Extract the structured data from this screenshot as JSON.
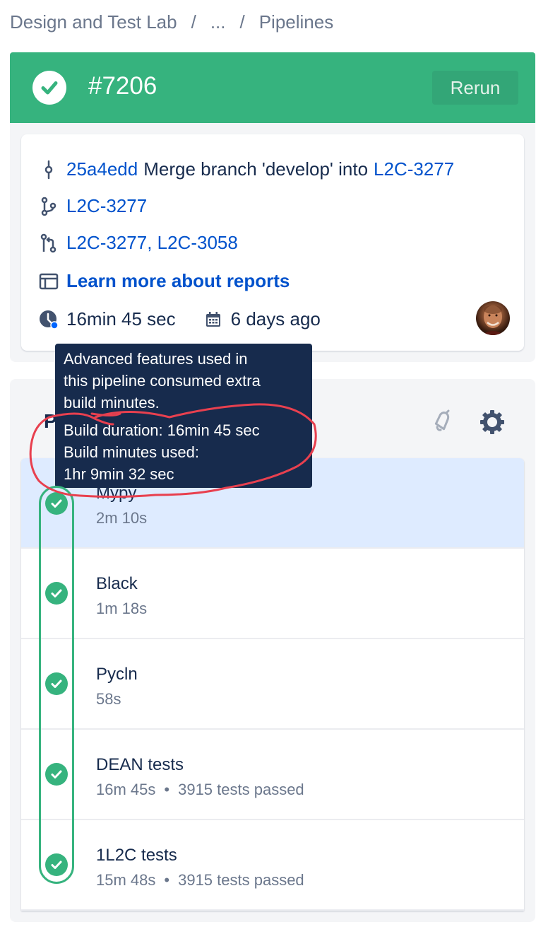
{
  "breadcrumb": {
    "items": [
      "Design and Test Lab",
      "...",
      "Pipelines"
    ],
    "separator": "/"
  },
  "header": {
    "status_icon": "check-circle-icon",
    "title": "#7206",
    "rerun_label": "Rerun",
    "color": "#36b37e"
  },
  "info": {
    "commit": {
      "icon": "commit-icon",
      "hash": "25a4edd",
      "message": "Merge branch 'develop' into",
      "target_branch": "L2C-3277"
    },
    "branch": {
      "icon": "branch-icon",
      "name": "L2C-3277"
    },
    "pull_requests": {
      "icon": "pull-request-icon",
      "text": "L2C-3277, L2C-3058"
    },
    "reports": {
      "icon": "report-icon",
      "label": "Learn more about reports"
    },
    "duration": {
      "icon": "clock-icon",
      "text": "16min 45 sec"
    },
    "date": {
      "icon": "calendar-icon",
      "text": "6 days ago"
    },
    "avatar": "user-avatar"
  },
  "tooltip": {
    "line1": "Advanced features used in",
    "line2": "this pipeline consumed extra",
    "line3": "build minutes.",
    "line4": "Build duration: 16min 45 sec",
    "line5": "Build minutes used:",
    "line6": "1hr 9min 32 sec"
  },
  "steps_section": {
    "heading": "P",
    "bell_icon": "bell-icon",
    "gear_icon": "gear-icon",
    "steps": [
      {
        "name": "Mypy",
        "duration": "2m 10s",
        "tests": "",
        "status": "success",
        "selected": true
      },
      {
        "name": "Black",
        "duration": "1m 18s",
        "tests": "",
        "status": "success",
        "selected": false
      },
      {
        "name": "Pycln",
        "duration": "58s",
        "tests": "",
        "status": "success",
        "selected": false
      },
      {
        "name": "DEAN tests",
        "duration": "16m 45s",
        "tests": "3915 tests passed",
        "status": "success",
        "selected": false
      },
      {
        "name": "1L2C tests",
        "duration": "15m 48s",
        "tests": "3915 tests passed",
        "status": "success",
        "selected": false
      }
    ],
    "meta_separator": "•"
  },
  "colors": {
    "success": "#36b37e",
    "link": "#0052cc",
    "text": "#172b4d",
    "muted": "#6b778c",
    "selected_row": "#deebff",
    "tooltip_bg": "#172b4d",
    "annotation_red": "#e8404f",
    "annotation_green": "#36b37e"
  }
}
